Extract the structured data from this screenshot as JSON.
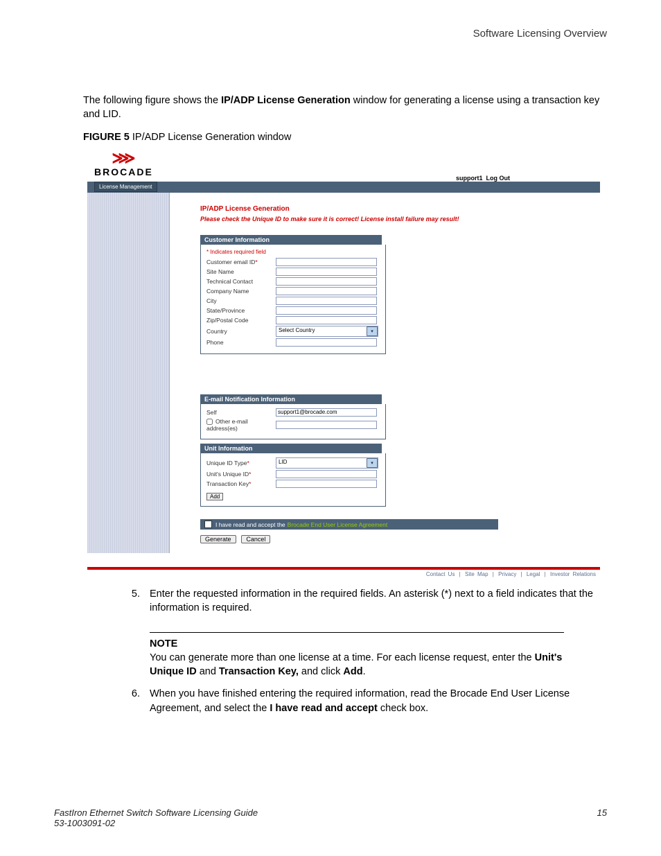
{
  "header": {
    "overview": "Software Licensing Overview"
  },
  "intro": {
    "prefix": "The following figure shows the ",
    "bold": "IP/ADP License Generation",
    "suffix": " window for generating a license using a transaction key and LID."
  },
  "figcaption": {
    "label": "FIGURE 5",
    "text": " IP/ADP License Generation window"
  },
  "logo": {
    "mark": "⋙",
    "text": "BROCADE"
  },
  "topnav": {
    "user": "support1",
    "logout": "Log Out",
    "tab": "License Management"
  },
  "license": {
    "title": "IP/ADP License Generation",
    "warn": "Please check the Unique ID to make sure it is correct! License install failure may result!"
  },
  "custinfo": {
    "hdr": "Customer Information",
    "req": "* Indicates required field",
    "email": "Customer email ID",
    "site": "Site Name",
    "tech": "Technical Contact",
    "company": "Company Name",
    "city": "City",
    "state": "State/Province",
    "zip": "Zip/Postal Code",
    "country": "Country",
    "country_sel": "Select Country",
    "phone": "Phone"
  },
  "emailnotif": {
    "hdr": "E-mail Notification Information",
    "self": "Self",
    "self_val": "support1@brocade.com",
    "other": "Other e-mail address(es)"
  },
  "unitinfo": {
    "hdr": "Unit Information",
    "idtype": "Unique ID Type",
    "idtype_sel": "LID",
    "uid": "Unit's Unique ID",
    "tkey": "Transaction Key",
    "add": "Add"
  },
  "agree": {
    "text": "I have read and accept the",
    "link": "Brocade End User License Agreement"
  },
  "buttons": {
    "generate": "Generate",
    "cancel": "Cancel"
  },
  "footerlinks": {
    "a": "Contact Us",
    "b": "Site Map",
    "c": "Privacy",
    "d": "Legal",
    "e": "Investor Relations"
  },
  "step5": {
    "num": "5.",
    "text": "Enter the requested information in the required fields. An asterisk (*) next to a field indicates that the information is required."
  },
  "note": {
    "title": "NOTE",
    "p1a": "You can generate more than one license at a time. For each license request, enter the ",
    "p1b": "Unit's Unique ID",
    "p1c": " and ",
    "p1d": "Transaction Key,",
    "p1e": " and click ",
    "p1f": "Add",
    "p1g": "."
  },
  "step6": {
    "num": "6.",
    "a": "When you have finished entering the required information, read the Brocade End User License Agreement, and select the ",
    "b": "I have read and accept",
    "c": " check box."
  },
  "pagefoot": {
    "title": "FastIron Ethernet Switch Software Licensing Guide",
    "docnum": "53-1003091-02",
    "pagenum": "15"
  }
}
